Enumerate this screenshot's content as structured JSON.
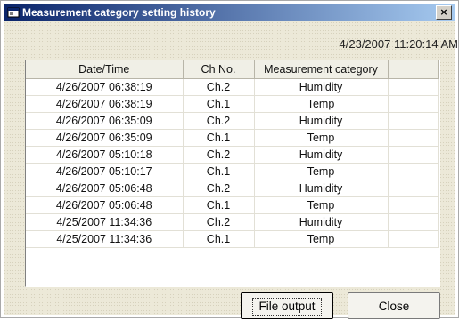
{
  "window": {
    "title": "Measurement category setting history",
    "close_glyph": "×",
    "icon": "app-window-icon"
  },
  "timestamp": "4/23/2007 11:20:14 AM",
  "table": {
    "columns": [
      "Date/Time",
      "Ch No.",
      "Measurement category",
      ""
    ],
    "rows": [
      {
        "datetime": "4/26/2007 06:38:19",
        "channel": "Ch.2",
        "category": "Humidity"
      },
      {
        "datetime": "4/26/2007 06:38:19",
        "channel": "Ch.1",
        "category": "Temp"
      },
      {
        "datetime": "4/26/2007 06:35:09",
        "channel": "Ch.2",
        "category": "Humidity"
      },
      {
        "datetime": "4/26/2007 06:35:09",
        "channel": "Ch.1",
        "category": "Temp"
      },
      {
        "datetime": "4/26/2007 05:10:18",
        "channel": "Ch.2",
        "category": "Humidity"
      },
      {
        "datetime": "4/26/2007 05:10:17",
        "channel": "Ch.1",
        "category": "Temp"
      },
      {
        "datetime": "4/26/2007 05:06:48",
        "channel": "Ch.2",
        "category": "Humidity"
      },
      {
        "datetime": "4/26/2007 05:06:48",
        "channel": "Ch.1",
        "category": "Temp"
      },
      {
        "datetime": "4/25/2007 11:34:36",
        "channel": "Ch.2",
        "category": "Humidity"
      },
      {
        "datetime": "4/25/2007 11:34:36",
        "channel": "Ch.1",
        "category": "Temp"
      }
    ]
  },
  "buttons": {
    "file_output": "File output",
    "close": "Close"
  }
}
